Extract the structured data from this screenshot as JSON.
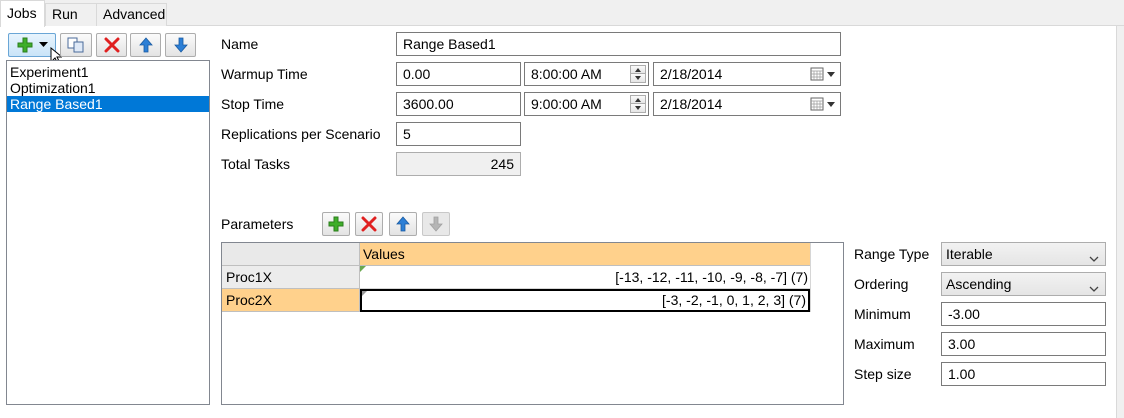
{
  "tabs": [
    {
      "label": "Jobs",
      "active": true
    },
    {
      "label": "Run",
      "active": false
    },
    {
      "label": "Advanced",
      "active": false
    }
  ],
  "toolbar": {
    "add_icon": "add-plus-icon",
    "dropdown_icon": "dropdown-arrow-icon",
    "copy_icon": "copy-icon",
    "delete_icon": "delete-x-icon",
    "move_up_icon": "arrow-up-icon",
    "move_down_icon": "arrow-down-icon"
  },
  "jobs": [
    "Experiment1",
    "Optimization1",
    "Range Based1"
  ],
  "selected_job": "Range Based1",
  "form": {
    "name_label": "Name",
    "name_value": "Range Based1",
    "warmup_label": "Warmup Time",
    "warmup_value": "0.00",
    "warmup_clock": "8:00:00 AM",
    "warmup_date": "2/18/2014",
    "stop_label": "Stop Time",
    "stop_value": "3600.00",
    "stop_clock": "9:00:00 AM",
    "stop_date": "2/18/2014",
    "replications_label": "Replications per Scenario",
    "replications_value": "5",
    "total_tasks_label": "Total Tasks",
    "total_tasks_value": "245"
  },
  "parameters": {
    "label": "Parameters",
    "column_header": "Values",
    "rows": [
      {
        "name": "Proc1X",
        "values": "[-13, -12, -11, -10, -9, -8, -7] (7)",
        "selected": false
      },
      {
        "name": "Proc2X",
        "values": "[-3, -2, -1, 0, 1, 2, 3] (7)",
        "selected": true
      }
    ]
  },
  "range": {
    "range_type_label": "Range Type",
    "range_type_value": "Iterable",
    "ordering_label": "Ordering",
    "ordering_value": "Ascending",
    "minimum_label": "Minimum",
    "minimum_value": "-3.00",
    "maximum_label": "Maximum",
    "maximum_value": "3.00",
    "step_label": "Step size",
    "step_value": "1.00"
  },
  "colors": {
    "selection_blue": "#0078d7",
    "header_orange": "#ffd18c",
    "row_selected_orange": "#ffd18c"
  }
}
